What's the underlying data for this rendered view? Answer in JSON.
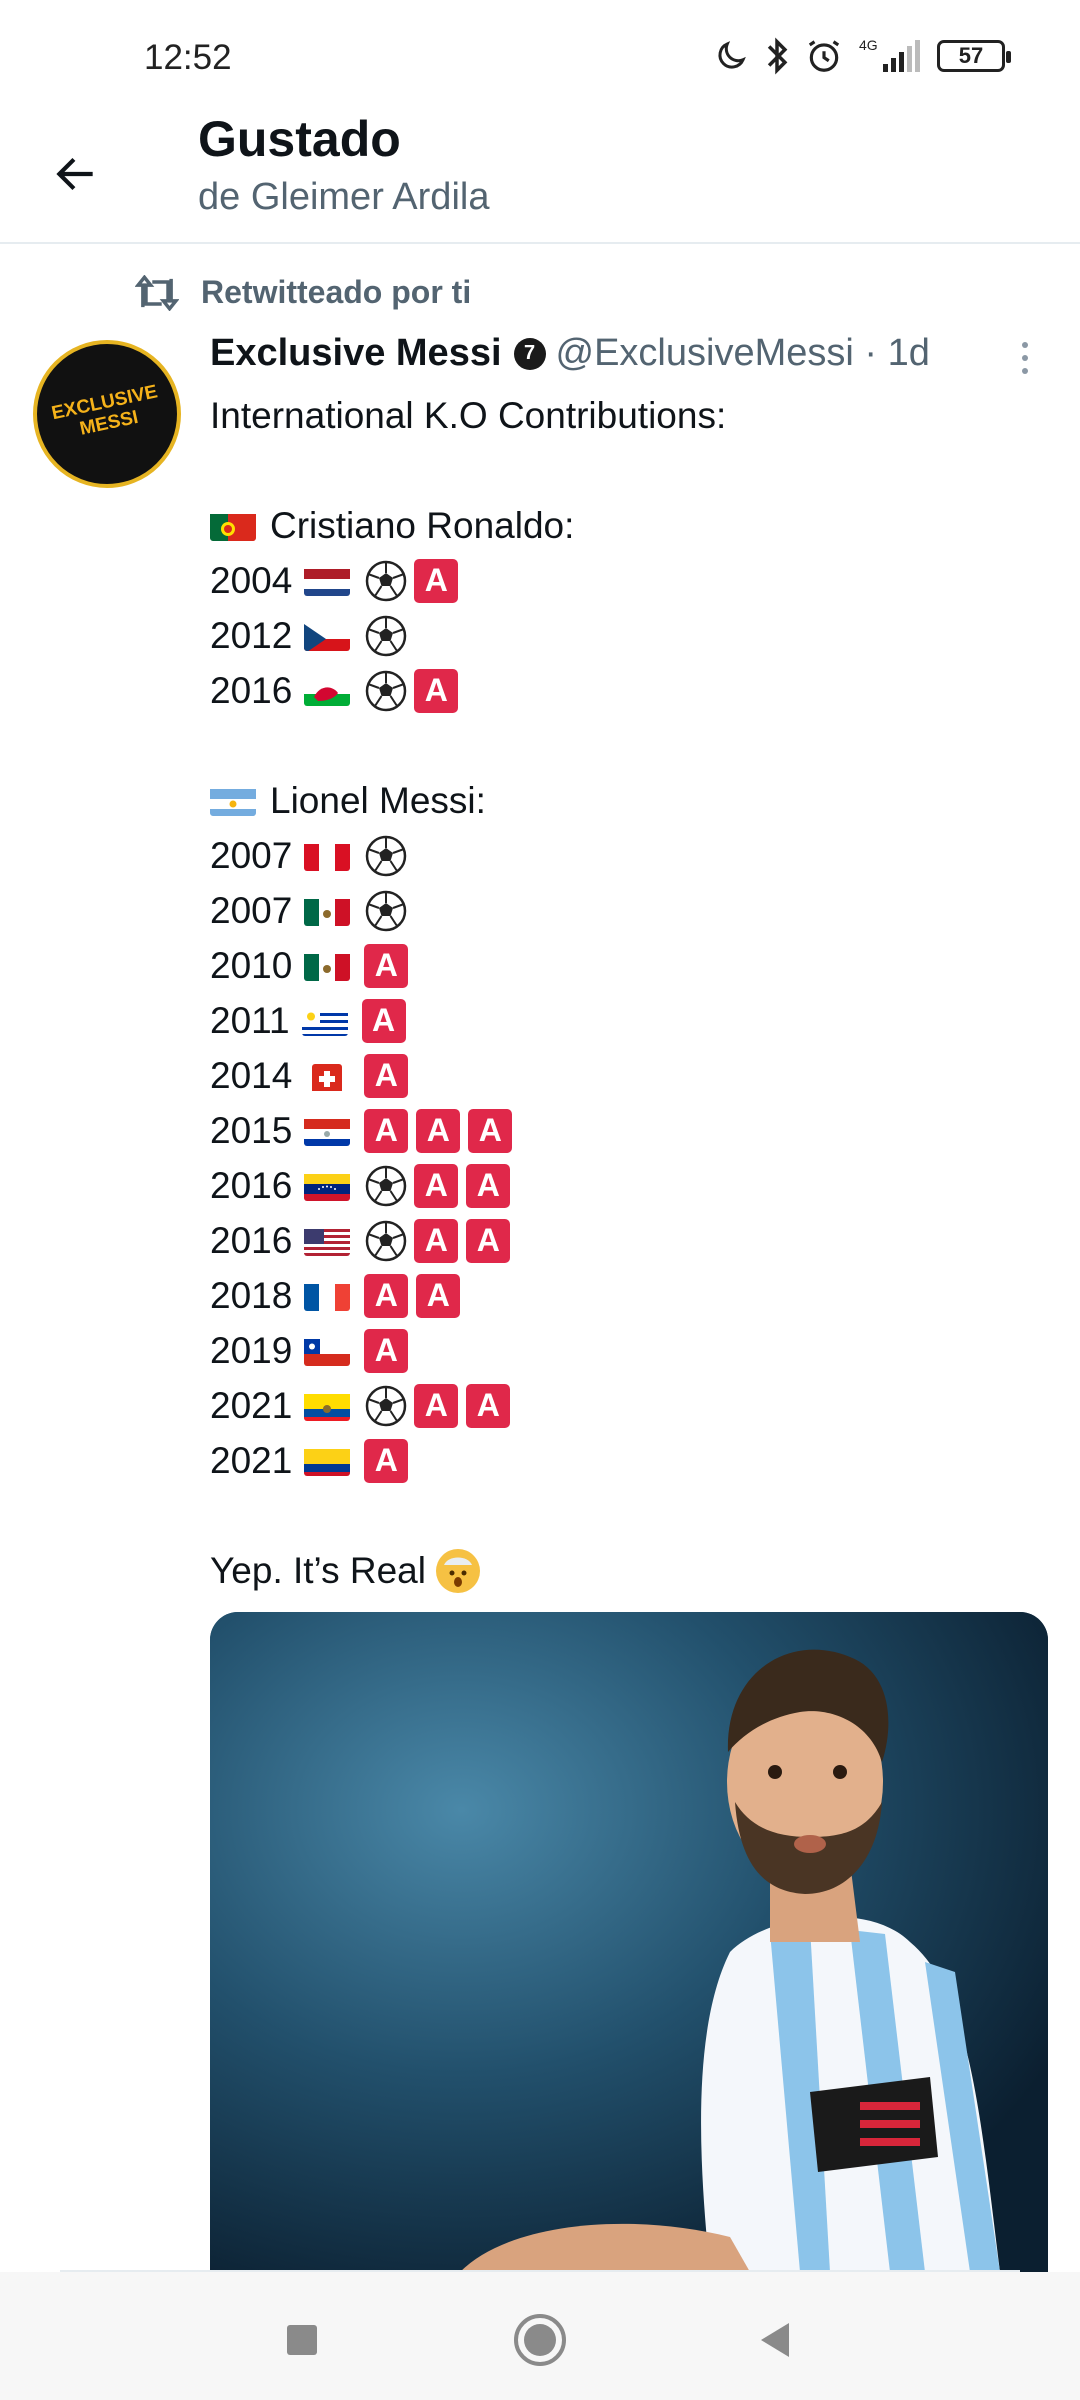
{
  "status_bar": {
    "time": "12:52",
    "network": "4G",
    "battery": "57"
  },
  "header": {
    "title": "Gustado",
    "subtitle": "de Gleimer Ardila"
  },
  "tweet": {
    "retweet_label": "Retwitteado por ti",
    "avatar_text": "EXCLUSIVE MESSI",
    "author_name": "Exclusive Messi",
    "badge": "7",
    "handle_time": "@ExclusiveMessi · 1d",
    "intro": "International K.O Contributions:",
    "cr_label": "Cristiano Ronaldo:",
    "cr_rows": [
      {
        "year": "2004",
        "flag": "netherlands",
        "items": [
          "ball",
          "assist"
        ]
      },
      {
        "year": "2012",
        "flag": "czech",
        "items": [
          "ball"
        ]
      },
      {
        "year": "2016",
        "flag": "wales",
        "items": [
          "ball",
          "assist"
        ]
      }
    ],
    "messi_label": "Lionel Messi:",
    "messi_rows": [
      {
        "year": "2007",
        "flag": "peru",
        "items": [
          "ball"
        ]
      },
      {
        "year": "2007",
        "flag": "mexico",
        "items": [
          "ball"
        ]
      },
      {
        "year": "2010",
        "flag": "mexico",
        "items": [
          "assist"
        ]
      },
      {
        "year": "2011",
        "flag": "uruguay",
        "items": [
          "assist"
        ]
      },
      {
        "year": "2014",
        "flag": "switzerland",
        "items": [
          "assist"
        ]
      },
      {
        "year": "2015",
        "flag": "paraguay",
        "items": [
          "assist",
          "assist",
          "assist"
        ]
      },
      {
        "year": "2016",
        "flag": "venezuela",
        "items": [
          "ball",
          "assist",
          "assist"
        ]
      },
      {
        "year": "2016",
        "flag": "usa",
        "items": [
          "ball",
          "assist",
          "assist"
        ]
      },
      {
        "year": "2018",
        "flag": "france",
        "items": [
          "assist",
          "assist"
        ]
      },
      {
        "year": "2019",
        "flag": "chile",
        "items": [
          "assist"
        ]
      },
      {
        "year": "2021",
        "flag": "ecuador",
        "items": [
          "ball",
          "assist",
          "assist"
        ]
      },
      {
        "year": "2021",
        "flag": "colombia",
        "items": [
          "assist"
        ]
      }
    ],
    "assist_letter": "A",
    "outro": "Yep. It’s Real"
  },
  "icons": {
    "status": [
      "moon-icon",
      "bluetooth-icon",
      "alarm-icon",
      "signal-icon",
      "battery-icon"
    ],
    "nav": [
      "recents-square-icon",
      "home-circle-icon",
      "back-triangle-icon"
    ]
  }
}
